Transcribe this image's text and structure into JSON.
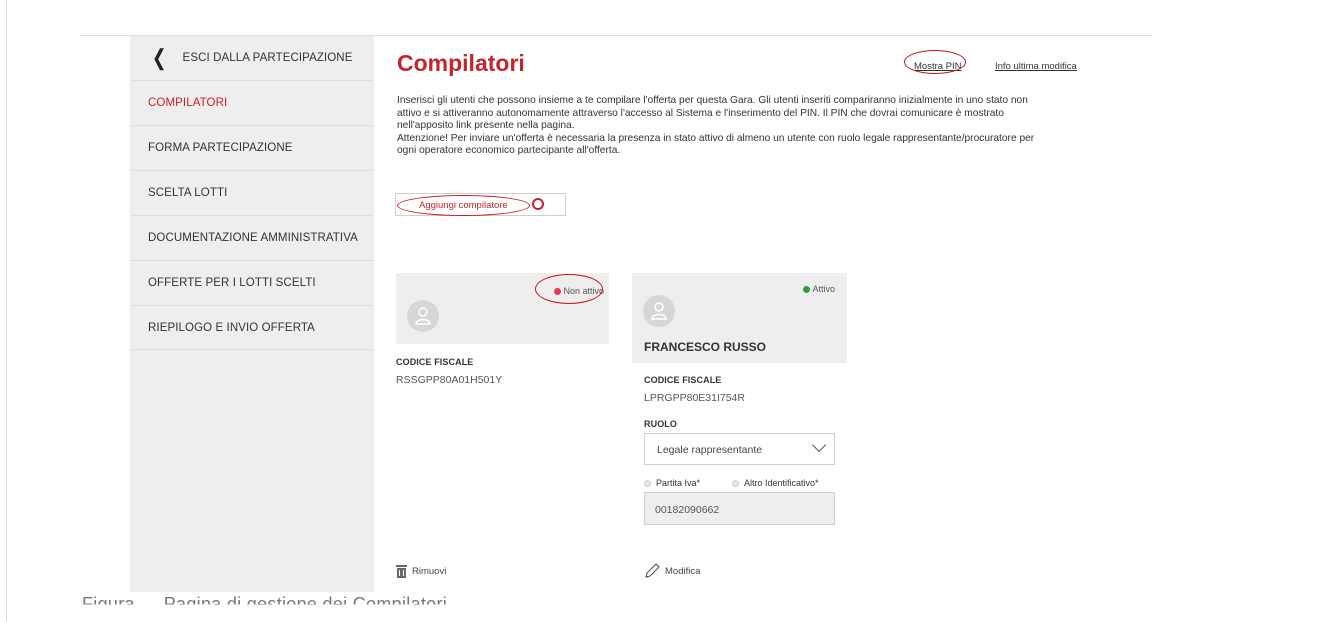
{
  "sidebar": {
    "back_label": "ESCI DALLA PARTECIPAZIONE",
    "items": [
      {
        "label": "COMPILATORI",
        "active": true
      },
      {
        "label": "FORMA PARTECIPAZIONE",
        "active": false
      },
      {
        "label": "SCELTA LOTTI",
        "active": false
      },
      {
        "label": "DOCUMENTAZIONE AMMINISTRATIVA",
        "active": false
      },
      {
        "label": "OFFERTE PER I LOTTI SCELTI",
        "active": false
      },
      {
        "label": "RIEPILOGO E INVIO OFFERTA",
        "active": false
      }
    ]
  },
  "main": {
    "title": "Compilatori",
    "show_pin_label": "Mostra PIN",
    "last_change_label": "Info ultima modifica",
    "description": [
      "Inserisci gli utenti che possono insieme a te compilare l'offerta per questa Gara. Gli utenti inseriti compariranno inizialmente in uno stato non",
      "attivo e si attiveranno autonomamente attraverso l'accesso al Sistema e l'inserimento del PIN. Il PIN che dovrai comunicare è mostrato",
      "nell'apposito link presente nella pagina.",
      "Attenzione! Per inviare un'offerta è necessaria la presenza in stato attivo di almeno un utente con ruolo legale rappresentante/procuratore per",
      "ogni operatore economico partecipante all'offerta."
    ],
    "add_button_label": "Aggiungi compilatore"
  },
  "cards": [
    {
      "status": "Non attivo",
      "status_color": "#e8394a",
      "fiscal_code_label": "CODICE FISCALE",
      "fiscal_code": "RSSGPP80A01H501Y",
      "action_label": "Rimuovi",
      "action_icon": "trash-icon"
    },
    {
      "status": "Attivo",
      "status_color": "#2e9e3e",
      "name": "FRANCESCO RUSSO",
      "fiscal_code_label": "CODICE FISCALE",
      "fiscal_code": "LPRGPP80E31I754R",
      "role_label": "RUOLO",
      "role_value": "Legale rappresentante",
      "radio_vat_label": "Partita Iva*",
      "radio_other_label": "Altro Identificativo*",
      "vat_value": "00182090662",
      "action_label": "Modifica",
      "action_icon": "pencil-icon"
    }
  ],
  "caption": "Figura … Pagina di gestione dei Compilatori",
  "colors": {
    "accent": "#c4242c",
    "annotation": "#c4161c",
    "sidebar_bg": "#eeeeee"
  }
}
